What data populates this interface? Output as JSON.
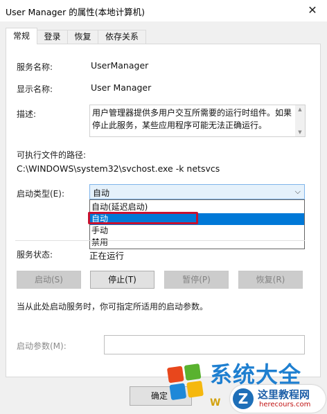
{
  "window": {
    "title": "User Manager 的属性(本地计算机)",
    "close_icon": "close-icon"
  },
  "tabs": [
    {
      "label": "常规",
      "active": true
    },
    {
      "label": "登录",
      "active": false
    },
    {
      "label": "恢复",
      "active": false
    },
    {
      "label": "依存关系",
      "active": false
    }
  ],
  "general": {
    "service_name_label": "服务名称:",
    "service_name_value": "UserManager",
    "display_name_label": "显示名称:",
    "display_name_value": "User Manager",
    "description_label": "描述:",
    "description_value": "用户管理器提供多用户交互所需要的运行时组件。如果停止此服务，某些应用程序可能无法正确运行。",
    "exe_path_label": "可执行文件的路径:",
    "exe_path_value": "C:\\WINDOWS\\system32\\svchost.exe -k netsvcs",
    "startup_type_label": "启动类型(E):",
    "startup_type_value": "自动",
    "startup_options": [
      "自动(延迟启动)",
      "自动",
      "手动",
      "禁用"
    ],
    "highlighted_option": "自动",
    "service_status_label": "服务状态:",
    "service_status_value": "正在运行"
  },
  "buttons": {
    "start": "启动(S)",
    "stop": "停止(T)",
    "pause": "暂停(P)",
    "resume": "恢复(R)",
    "confirm": "确定"
  },
  "hint": "当从此处启动服务时，你可指定所适用的启动参数。",
  "start_params_label": "启动参数(M):",
  "start_params_value": "",
  "watermark": {
    "big_text": "系统大全",
    "site_name": "这里教程网",
    "url": "herecours.com",
    "w_letter": "W"
  },
  "colors": {
    "selection": "#0078d7",
    "highlight_outline": "#c8102e",
    "combo_bg": "#e5f1fb",
    "combo_border": "#7eb4ea"
  }
}
